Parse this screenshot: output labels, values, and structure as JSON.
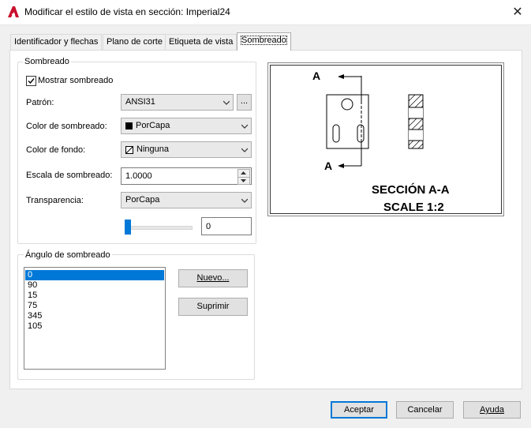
{
  "window": {
    "title": "Modificar el estilo de vista en sección: Imperial24",
    "close": "✕"
  },
  "tabs": [
    {
      "label": "Identificador y flechas"
    },
    {
      "label": "Plano de corte"
    },
    {
      "label": "Etiqueta de vista"
    },
    {
      "label": "Sombreado",
      "active": true
    }
  ],
  "hatch_group": {
    "title": "Sombreado",
    "show_hatch": {
      "label": "Mostrar sombreado",
      "checked": true
    },
    "pattern": {
      "label": "Patrón:",
      "value": "ANSI31",
      "browse": "..."
    },
    "hatch_color": {
      "label": "Color de sombreado:",
      "value": "PorCapa"
    },
    "background_color": {
      "label": "Color de fondo:",
      "value": "Ninguna"
    },
    "hatch_scale": {
      "label": "Escala de sombreado:",
      "value": "1.0000"
    },
    "transparency": {
      "label": "Transparencia:",
      "value": "PorCapa",
      "slider_value": "0",
      "slider_fraction": 0
    }
  },
  "angle_group": {
    "title": "Ángulo de sombreado",
    "angles": [
      "0",
      "90",
      "15",
      "75",
      "345",
      "105"
    ],
    "selected_index": 0,
    "new_button": "Nuevo...",
    "delete_button": "Suprimir"
  },
  "preview": {
    "arrow_label_top": "A",
    "arrow_label_bottom": "A",
    "caption_line1": "SECCIÓN A-A",
    "caption_line2": "SCALE 1:2"
  },
  "footer": {
    "accept": "Aceptar",
    "cancel": "Cancelar",
    "help": "Ayuda"
  },
  "colors": {
    "accent": "#0078d7",
    "title_icon": "#c8102e"
  }
}
